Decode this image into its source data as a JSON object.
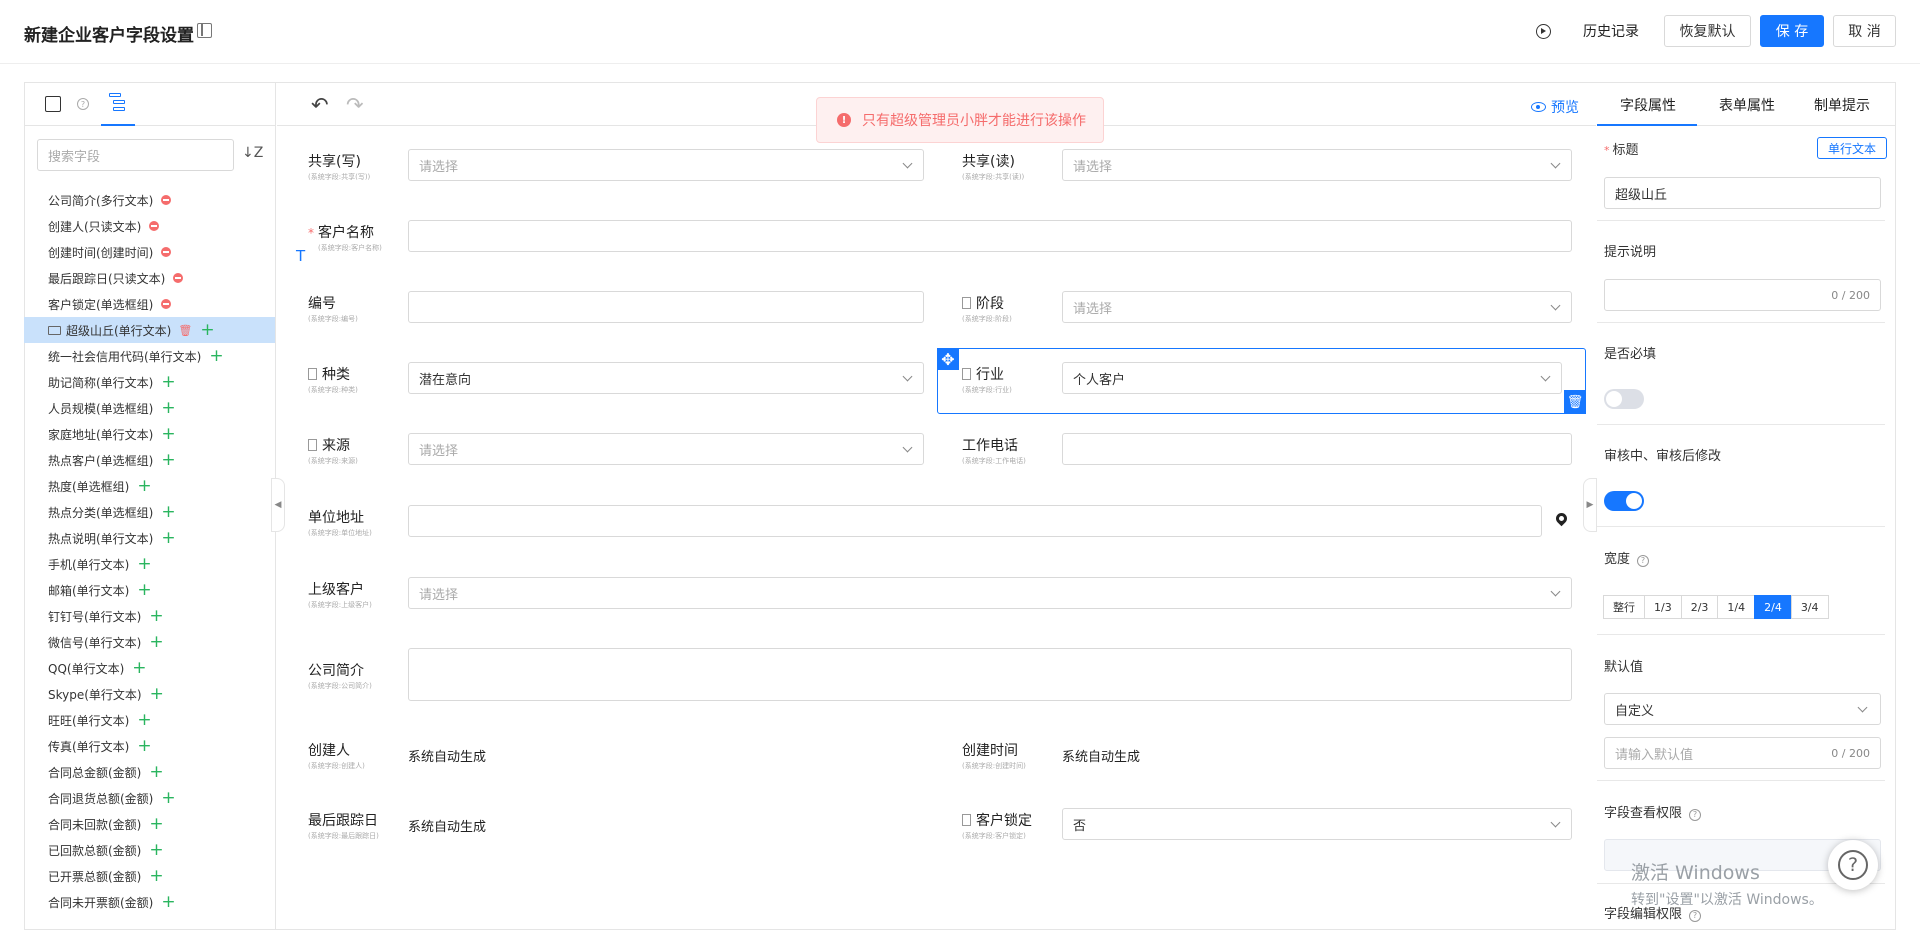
{
  "header": {
    "title": "新建企业客户字段设置",
    "history": "历史记录",
    "restore": "恢复默认",
    "save": "保 存",
    "cancel": "取 消"
  },
  "toast": {
    "message": "只有超级管理员小胖才能进行该操作",
    "icon": "!"
  },
  "left": {
    "search_placeholder": "搜索字段",
    "sort_icon": "↓Z",
    "items": [
      {
        "label": "公司简介(多行文本)",
        "action": "remove"
      },
      {
        "label": "创建人(只读文本)",
        "action": "remove"
      },
      {
        "label": "创建时间(创建时间)",
        "action": "remove"
      },
      {
        "label": "最后跟踪日(只读文本)",
        "action": "remove"
      },
      {
        "label": "客户锁定(单选框组)",
        "action": "remove"
      },
      {
        "label": "超级山丘(单行文本)",
        "action": "selected"
      },
      {
        "label": "统一社会信用代码(单行文本)",
        "action": "add"
      },
      {
        "label": "助记简称(单行文本)",
        "action": "add"
      },
      {
        "label": "人员规模(单选框组)",
        "action": "add"
      },
      {
        "label": "家庭地址(单行文本)",
        "action": "add"
      },
      {
        "label": "热点客户(单选框组)",
        "action": "add"
      },
      {
        "label": "热度(单选框组)",
        "action": "add"
      },
      {
        "label": "热点分类(单选框组)",
        "action": "add"
      },
      {
        "label": "热点说明(单行文本)",
        "action": "add"
      },
      {
        "label": "手机(单行文本)",
        "action": "add"
      },
      {
        "label": "邮箱(单行文本)",
        "action": "add"
      },
      {
        "label": "钉钉号(单行文本)",
        "action": "add"
      },
      {
        "label": "微信号(单行文本)",
        "action": "add"
      },
      {
        "label": "QQ(单行文本)",
        "action": "add"
      },
      {
        "label": "Skype(单行文本)",
        "action": "add"
      },
      {
        "label": "旺旺(单行文本)",
        "action": "add"
      },
      {
        "label": "传真(单行文本)",
        "action": "add"
      },
      {
        "label": "合同总金额(金额)",
        "action": "add"
      },
      {
        "label": "合同退货总额(金额)",
        "action": "add"
      },
      {
        "label": "合同未回款(金额)",
        "action": "add"
      },
      {
        "label": "已回款总额(金额)",
        "action": "add"
      },
      {
        "label": "已开票总额(金额)",
        "action": "add"
      },
      {
        "label": "合同未开票额(金额)",
        "action": "add"
      }
    ]
  },
  "center": {
    "preview": "预览",
    "placeholder_select": "请选择",
    "auto": "系统自动生成",
    "fields": {
      "share_w": {
        "label": "共享(写)",
        "sub": "(系统字段:共享(写))"
      },
      "share_r": {
        "label": "共享(读)",
        "sub": "(系统字段:共享(读))"
      },
      "name": {
        "label": "客户名称",
        "sub": "(系统字段:客户名称)",
        "required": "*"
      },
      "code": {
        "label": "编号",
        "sub": "(系统字段:编号)"
      },
      "stage": {
        "label": "阶段",
        "sub": "(系统字段:阶段)"
      },
      "kind": {
        "label": "种类",
        "sub": "(系统字段:种类)",
        "value": "潜在意向"
      },
      "industry": {
        "label": "行业",
        "sub": "(系统字段:行业)",
        "value": "个人客户"
      },
      "source": {
        "label": "来源",
        "sub": "(系统字段:来源)"
      },
      "phone": {
        "label": "工作电话",
        "sub": "(系统字段:工作电话)"
      },
      "address": {
        "label": "单位地址",
        "sub": "(系统字段:单位地址)"
      },
      "parent": {
        "label": "上级客户",
        "sub": "(系统字段:上级客户)"
      },
      "intro": {
        "label": "公司简介",
        "sub": "(系统字段:公司简介)"
      },
      "creator": {
        "label": "创建人",
        "sub": "(系统字段:创建人)"
      },
      "ctime": {
        "label": "创建时间",
        "sub": "(系统字段:创建时间)"
      },
      "last": {
        "label": "最后跟踪日",
        "sub": "(系统字段:最后跟踪日)"
      },
      "lock": {
        "label": "客户锁定",
        "sub": "(系统字段:客户锁定)",
        "value": "否"
      }
    }
  },
  "right": {
    "tabs": [
      "字段属性",
      "表单属性",
      "制单提示"
    ],
    "title_label": "标题",
    "title_required": "*",
    "type_tag": "单行文本",
    "title_value": "超级山丘",
    "hint_label": "提示说明",
    "hint_count": "0 / 200",
    "required_label": "是否必填",
    "edit_label": "审核中、审核后修改",
    "width_label": "宽度",
    "width_options": [
      "整行",
      "1/3",
      "2/3",
      "1/4",
      "2/4",
      "3/4"
    ],
    "width_selected": "2/4",
    "default_label": "默认值",
    "default_type": "自定义",
    "default_placeholder": "请输入默认值",
    "default_count": "0 / 200",
    "view_perm_label": "字段查看权限",
    "edit_perm_label": "字段编辑权限",
    "help_mark": "?"
  },
  "watermark": {
    "line1": "激活 Windows",
    "line2": "转到\"设置\"以激活 Windows。"
  },
  "colors": {
    "primary": "#1677ff",
    "danger": "#f56c6c",
    "add": "#2ab55f"
  }
}
